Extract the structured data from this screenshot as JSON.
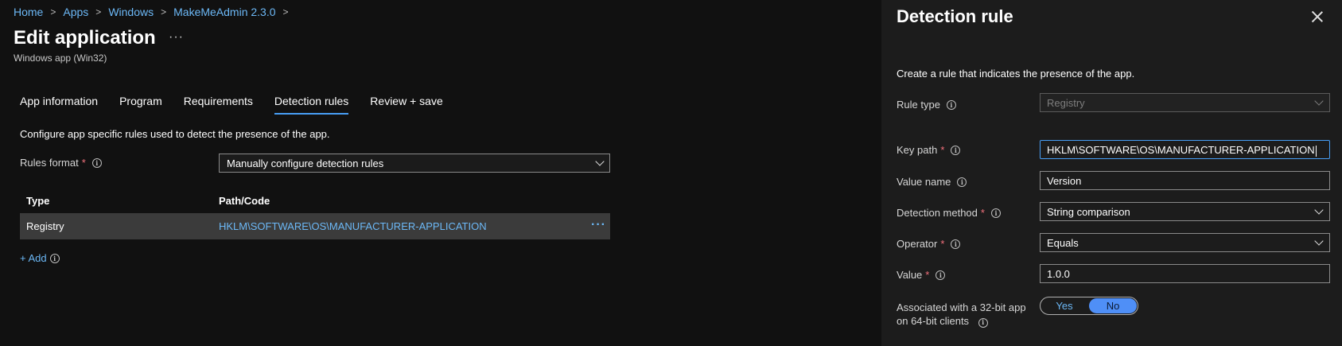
{
  "breadcrumb": [
    "Home",
    "Apps",
    "Windows",
    "MakeMeAdmin 2.3.0"
  ],
  "page": {
    "title": "Edit application",
    "more": "···",
    "subtitle": "Windows app (Win32)"
  },
  "tabs": [
    {
      "label": "App information",
      "active": false
    },
    {
      "label": "Program",
      "active": false
    },
    {
      "label": "Requirements",
      "active": false
    },
    {
      "label": "Detection rules",
      "active": true
    },
    {
      "label": "Review + save",
      "active": false
    }
  ],
  "detection": {
    "description": "Configure app specific rules used to detect the presence of the app.",
    "rules_format_label": "Rules format",
    "rules_format_value": "Manually configure detection rules",
    "table": {
      "headers": [
        "Type",
        "Path/Code"
      ],
      "rows": [
        {
          "type": "Registry",
          "path": "HKLM\\SOFTWARE\\OS\\MANUFACTURER-APPLICATION"
        }
      ]
    },
    "add_label": "+ Add"
  },
  "panel": {
    "title": "Detection rule",
    "description": "Create a rule that indicates the presence of the app.",
    "rule_type_label": "Rule type",
    "rule_type_value": "Registry",
    "key_path_label": "Key path",
    "key_path_value": "HKLM\\SOFTWARE\\OS\\MANUFACTURER-APPLICATION",
    "value_name_label": "Value name",
    "value_name_value": "Version",
    "detection_method_label": "Detection method",
    "detection_method_value": "String comparison",
    "operator_label": "Operator",
    "operator_value": "Equals",
    "value_label": "Value",
    "value_value": "1.0.0",
    "assoc_label_line1": "Associated with a 32-bit app",
    "assoc_label_line2": "on 64-bit clients",
    "toggle_yes": "Yes",
    "toggle_no": "No",
    "toggle_selected": "No"
  },
  "colors": {
    "accent": "#479ef5",
    "link": "#6cb8f6",
    "required": "#f1707b",
    "toggle_on": "#4f8ff7"
  }
}
